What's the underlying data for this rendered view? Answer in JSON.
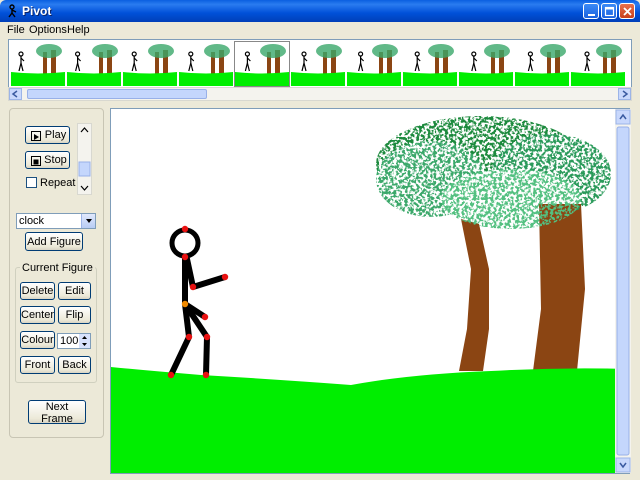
{
  "window": {
    "title": "Pivot"
  },
  "menu": [
    "File",
    "Options",
    "Help"
  ],
  "frames": {
    "count": 11,
    "selected_index": 4
  },
  "controls": {
    "play_label": "Play",
    "stop_label": "Stop",
    "repeat_label": "Repeat",
    "repeat_checked": false,
    "figure_type": "clock",
    "add_figure_label": "Add Figure",
    "current_figure_label": "Current Figure",
    "delete_label": "Delete",
    "edit_label": "Edit",
    "center_label": "Center",
    "flip_label": "Flip",
    "colour_label": "Colour",
    "colour_value": "100",
    "front_label": "Front",
    "back_label": "Back",
    "next_frame_label": "Next Frame"
  },
  "colors": {
    "grass": "#00ee00",
    "trunk": "#8b4513",
    "foliage": "#3aa86a",
    "figure": "#000000",
    "joint": "#e81010",
    "anchor_joint": "#f08a00"
  }
}
